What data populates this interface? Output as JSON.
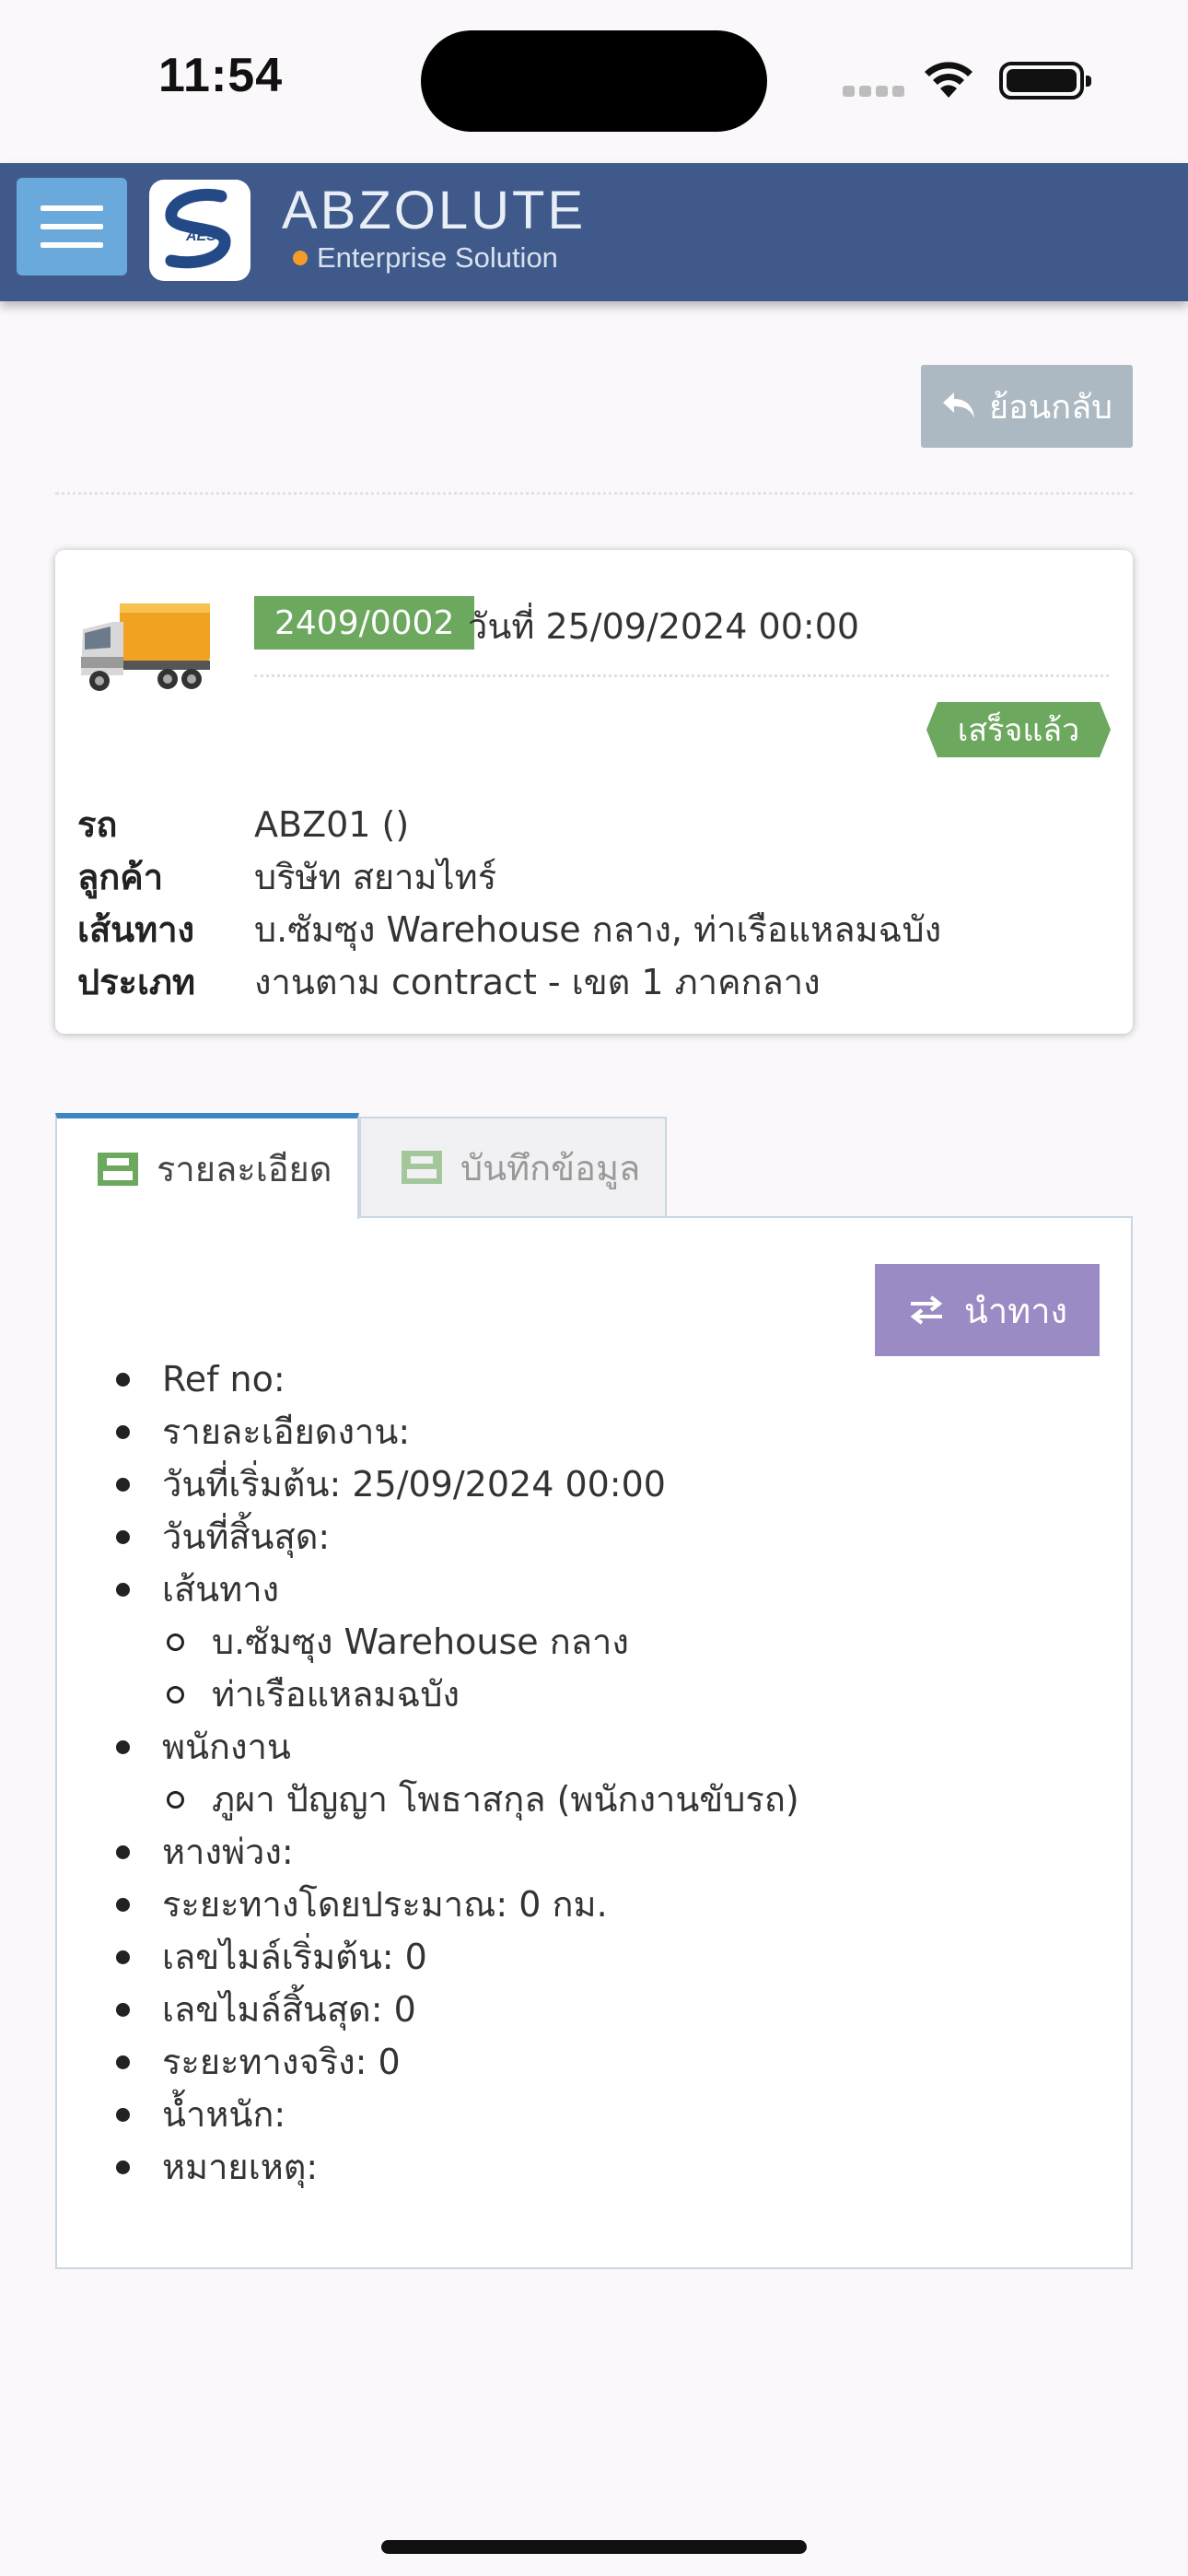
{
  "status_bar": {
    "time": "11:54"
  },
  "header": {
    "brand": "ABZOLUTE",
    "tagline": "Enterprise Solution",
    "logo_text": "AES"
  },
  "toolbar": {
    "back_label": "ย้อนกลับ"
  },
  "job_card": {
    "job_no": "2409/0002",
    "date_text": "วันที่ 25/09/2024 00:00",
    "status": "เสร็จแล้ว",
    "fields": [
      {
        "label": "รถ",
        "value": "ABZ01 ()"
      },
      {
        "label": "ลูกค้า",
        "value": "บริษัท สยามไทร์"
      },
      {
        "label": "เส้นทาง",
        "value": "บ.ซัมซุง Warehouse กลาง, ท่าเรือแหลมฉบัง"
      },
      {
        "label": "ประเภท",
        "value": "งานตาม contract - เขต 1 ภาคกลาง"
      }
    ]
  },
  "tabs": [
    {
      "label": "รายละเอียด",
      "active": true
    },
    {
      "label": "บันทึกข้อมูล",
      "active": false
    }
  ],
  "detail": {
    "navigate_label": "นำทาง",
    "items": [
      {
        "text": "Ref no:",
        "level": 1
      },
      {
        "text": "รายละเอียดงาน:",
        "level": 1
      },
      {
        "text": "วันที่เริ่มต้น: 25/09/2024 00:00",
        "level": 1
      },
      {
        "text": "วันที่สิ้นสุด:",
        "level": 1
      },
      {
        "text": "เส้นทาง",
        "level": 1
      },
      {
        "text": "บ.ซัมซุง Warehouse กลาง",
        "level": 2
      },
      {
        "text": "ท่าเรือแหลมฉบัง",
        "level": 2
      },
      {
        "text": "พนักงาน",
        "level": 1
      },
      {
        "text": "ภูผา ปัญญา โพธาสกุล (พนักงานขับรถ)",
        "level": 2
      },
      {
        "text": "หางพ่วง:",
        "level": 1
      },
      {
        "text": "ระยะทางโดยประมาณ: 0 กม.",
        "level": 1
      },
      {
        "text": "เลขไมล์เริ่มต้น: 0",
        "level": 1
      },
      {
        "text": "เลขไมล์สิ้นสุด: 0",
        "level": 1
      },
      {
        "text": "ระยะทางจริง: 0",
        "level": 1
      },
      {
        "text": "น้ำหนัก:",
        "level": 1
      },
      {
        "text": "หมายเหตุ:",
        "level": 1
      }
    ]
  },
  "colors": {
    "navbar": "#3f5a8a",
    "success": "#6ca85e",
    "navigate": "#9b8bc4",
    "back": "#adb9c2",
    "tab_active": "#3d86c6"
  },
  "icons": [
    "menu-icon",
    "back-arrow-icon",
    "truck-icon",
    "inbox-tray-icon",
    "swap-arrows-icon",
    "wifi-icon",
    "battery-icon",
    "signal-icon"
  ]
}
